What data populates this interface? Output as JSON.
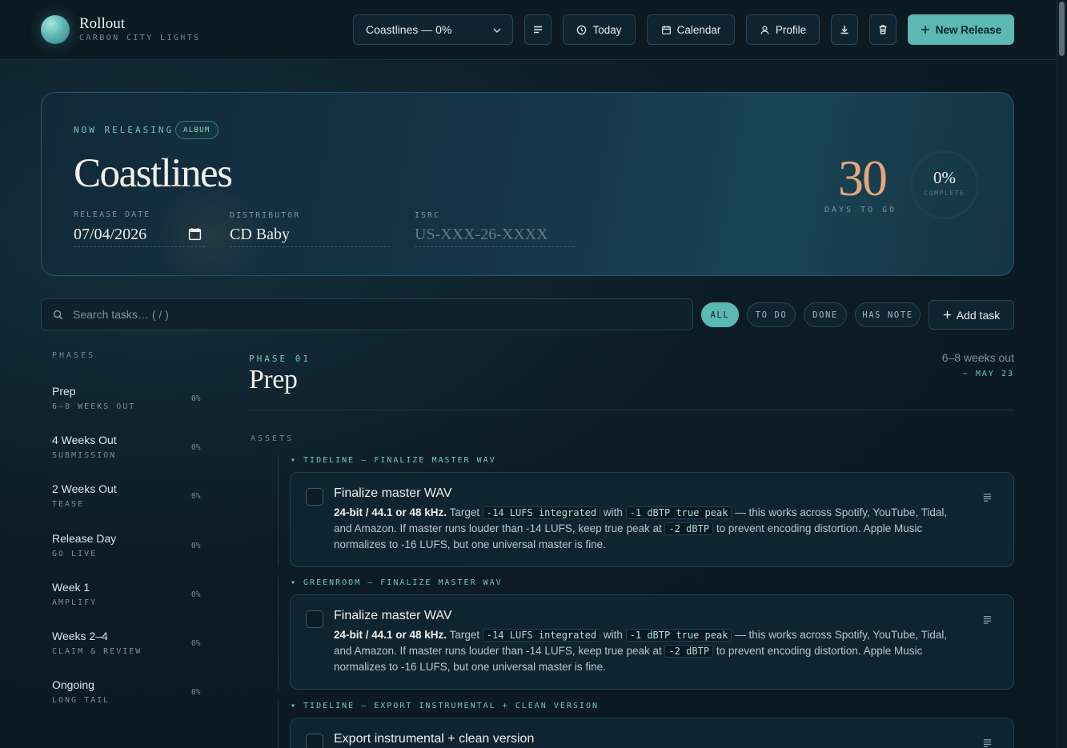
{
  "header": {
    "brand_name": "Rollout",
    "brand_sub": "CARBON CITY LIGHTS",
    "release_select": "Coastlines — 0%",
    "today": "Today",
    "calendar": "Calendar",
    "profile": "Profile",
    "new_release": "New Release"
  },
  "hero": {
    "eyebrow": "NOW RELEASING",
    "badge": "ALBUM",
    "title": "Coastlines",
    "release_date_label": "RELEASE DATE",
    "release_date": "07/04/2026",
    "distributor_label": "DISTRIBUTOR",
    "distributor": "CD Baby",
    "isrc_label": "ISRC",
    "isrc_placeholder": "US-XXX-26-XXXX",
    "days_number": "30",
    "days_label": "DAYS TO GO",
    "complete_pct": "0%",
    "complete_label": "COMPLETE"
  },
  "toolbar": {
    "search_placeholder": "Search tasks… ( / )",
    "filters": [
      "ALL",
      "TO DO",
      "DONE",
      "HAS NOTE"
    ],
    "add_task": "Add task"
  },
  "sidebar": {
    "title": "PHASES",
    "phases": [
      {
        "name": "Prep",
        "sub": "6–8 WEEKS OUT",
        "pct": "0%"
      },
      {
        "name": "4 Weeks Out",
        "sub": "SUBMISSION",
        "pct": "0%"
      },
      {
        "name": "2 Weeks Out",
        "sub": "TEASE",
        "pct": "0%"
      },
      {
        "name": "Release Day",
        "sub": "GO LIVE",
        "pct": "0%"
      },
      {
        "name": "Week 1",
        "sub": "AMPLIFY",
        "pct": "0%"
      },
      {
        "name": "Weeks 2–4",
        "sub": "CLAIM & REVIEW",
        "pct": "0%"
      },
      {
        "name": "Ongoing",
        "sub": "LONG TAIL",
        "pct": "0%"
      }
    ]
  },
  "main": {
    "phase_num": "PHASE 01",
    "phase_title": "Prep",
    "weeks_out": "6–8 weeks out",
    "weeks_date": "~ MAY 23",
    "section": "ASSETS",
    "groups": [
      {
        "title": "▾ TIDELINE — FINALIZE MASTER WAV",
        "task": {
          "title": "Finalize master WAV",
          "desc_bold": "24-bit / 44.1 or 48 kHz.",
          "desc_1": " Target ",
          "code_1": "-14 LUFS integrated",
          "desc_2": " with ",
          "code_2": "-1 dBTP true peak",
          "desc_3": " — this works across Spotify, YouTube, Tidal, and Amazon. If master runs louder than -14 LUFS, keep true peak at ",
          "code_3": "-2 dBTP",
          "desc_4": " to prevent encoding distortion. Apple Music normalizes to -16 LUFS, but one universal master is fine."
        }
      },
      {
        "title": "▾ GREENROOM — FINALIZE MASTER WAV",
        "task": {
          "title": "Finalize master WAV",
          "desc_bold": "24-bit / 44.1 or 48 kHz.",
          "desc_1": " Target ",
          "code_1": "-14 LUFS integrated",
          "desc_2": " with ",
          "code_2": "-1 dBTP true peak",
          "desc_3": " — this works across Spotify, YouTube, Tidal, and Amazon. If master runs louder than -14 LUFS, keep true peak at ",
          "code_3": "-2 dBTP",
          "desc_4": " to prevent encoding distortion. Apple Music normalizes to -16 LUFS, but one universal master is fine."
        }
      },
      {
        "title": "▾ TIDELINE — EXPORT INSTRUMENTAL + CLEAN VERSION",
        "task": {
          "title": "Export instrumental + clean version"
        }
      }
    ]
  },
  "colors": {
    "accent": "#5bb8b2",
    "days_number": "#e5a57b",
    "background": "#0c1c26"
  }
}
